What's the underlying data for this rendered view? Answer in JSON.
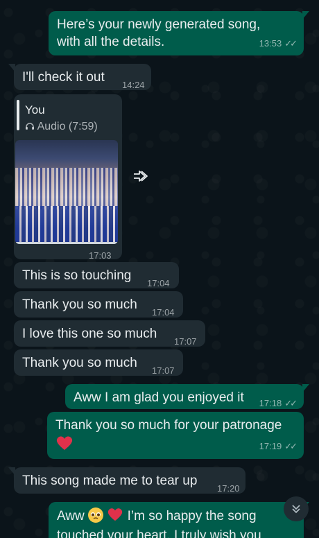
{
  "messages": [
    {
      "id": "m1",
      "dir": "out",
      "text": "Here’s your newly generated song, with all the details.",
      "time": "13:53",
      "ticks": "✓✓"
    },
    {
      "id": "m2",
      "dir": "in",
      "text": "I'll check it out",
      "time": "14:24"
    },
    {
      "id": "m3",
      "dir": "in",
      "quote_name": "You",
      "quote_sub": "Audio (7:59)",
      "time": "17:03"
    },
    {
      "id": "m4",
      "dir": "in",
      "text": "This is so touching",
      "time": "17:04"
    },
    {
      "id": "m5",
      "dir": "in",
      "text": "Thank you so much",
      "time": "17:04"
    },
    {
      "id": "m6",
      "dir": "in",
      "text": "I love this one so much",
      "time": "17:07"
    },
    {
      "id": "m7",
      "dir": "in",
      "text": "Thank you so much",
      "time": "17:07"
    },
    {
      "id": "m8",
      "dir": "out",
      "text": "Aww I am glad you enjoyed it",
      "time": "17:18",
      "ticks": "✓✓"
    },
    {
      "id": "m9",
      "dir": "out",
      "text": "Thank you so much for your patronage",
      "emoji": "❤️",
      "time": "17:19",
      "ticks": "✓✓"
    },
    {
      "id": "m10",
      "dir": "in",
      "text": "This song made me to tear up",
      "time": "17:20"
    },
    {
      "id": "m11",
      "dir": "out",
      "text_a": "Aww",
      "text_b": "I’m so happy the song",
      "text_c": "touched your heart. I truly wish you"
    }
  ],
  "colors": {
    "incoming": "#202c33",
    "outgoing": "#005c4b",
    "background": "#0b141a"
  },
  "icons": {
    "forward": "forward-icon",
    "headphones": "headphones-icon",
    "scroll_down": "chevron-down-icon"
  }
}
